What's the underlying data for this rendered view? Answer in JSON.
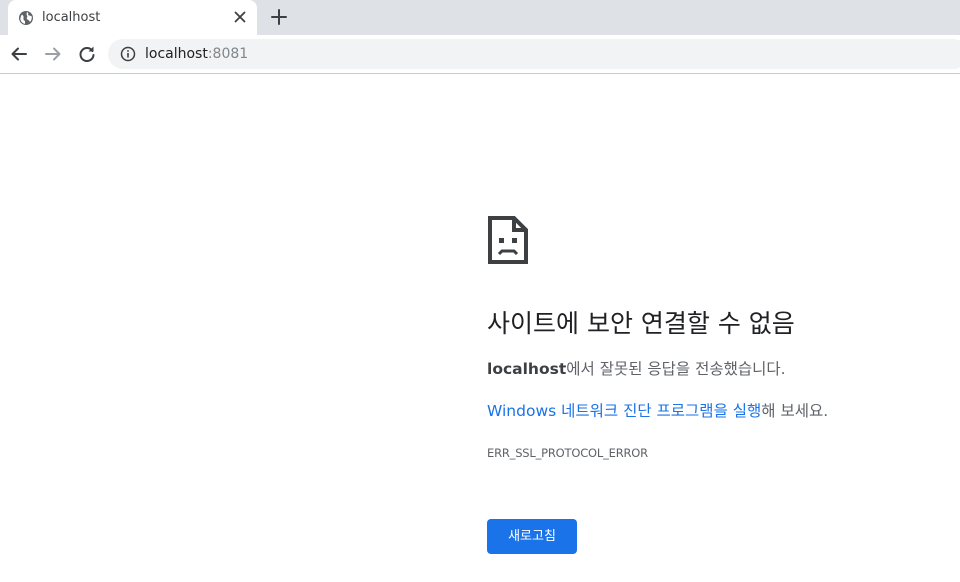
{
  "tab": {
    "title": "localhost",
    "favicon": "globe-icon",
    "close": "close-icon"
  },
  "toolbar": {
    "back": "back-arrow-icon",
    "forward": "forward-arrow-icon",
    "reload": "reload-icon",
    "new_tab": "plus-icon"
  },
  "omnibox": {
    "info_icon": "info-icon",
    "host": "localhost",
    "port": ":8081"
  },
  "error": {
    "icon": "sad-page-icon",
    "headline": "사이트에 보안 연결할 수 없음",
    "host_bold": "localhost",
    "host_suffix": "에서 잘못된 응답을 전송했습니다.",
    "diagnostics_link": "Windows 네트워크 진단 프로그램을 실행",
    "diagnostics_suffix": "해 보세요.",
    "code": "ERR_SSL_PROTOCOL_ERROR",
    "reload_label": "새로고침"
  },
  "colors": {
    "accent": "#1a73e8",
    "tabstrip": "#dee1e6",
    "omnibox": "#f1f3f4"
  }
}
